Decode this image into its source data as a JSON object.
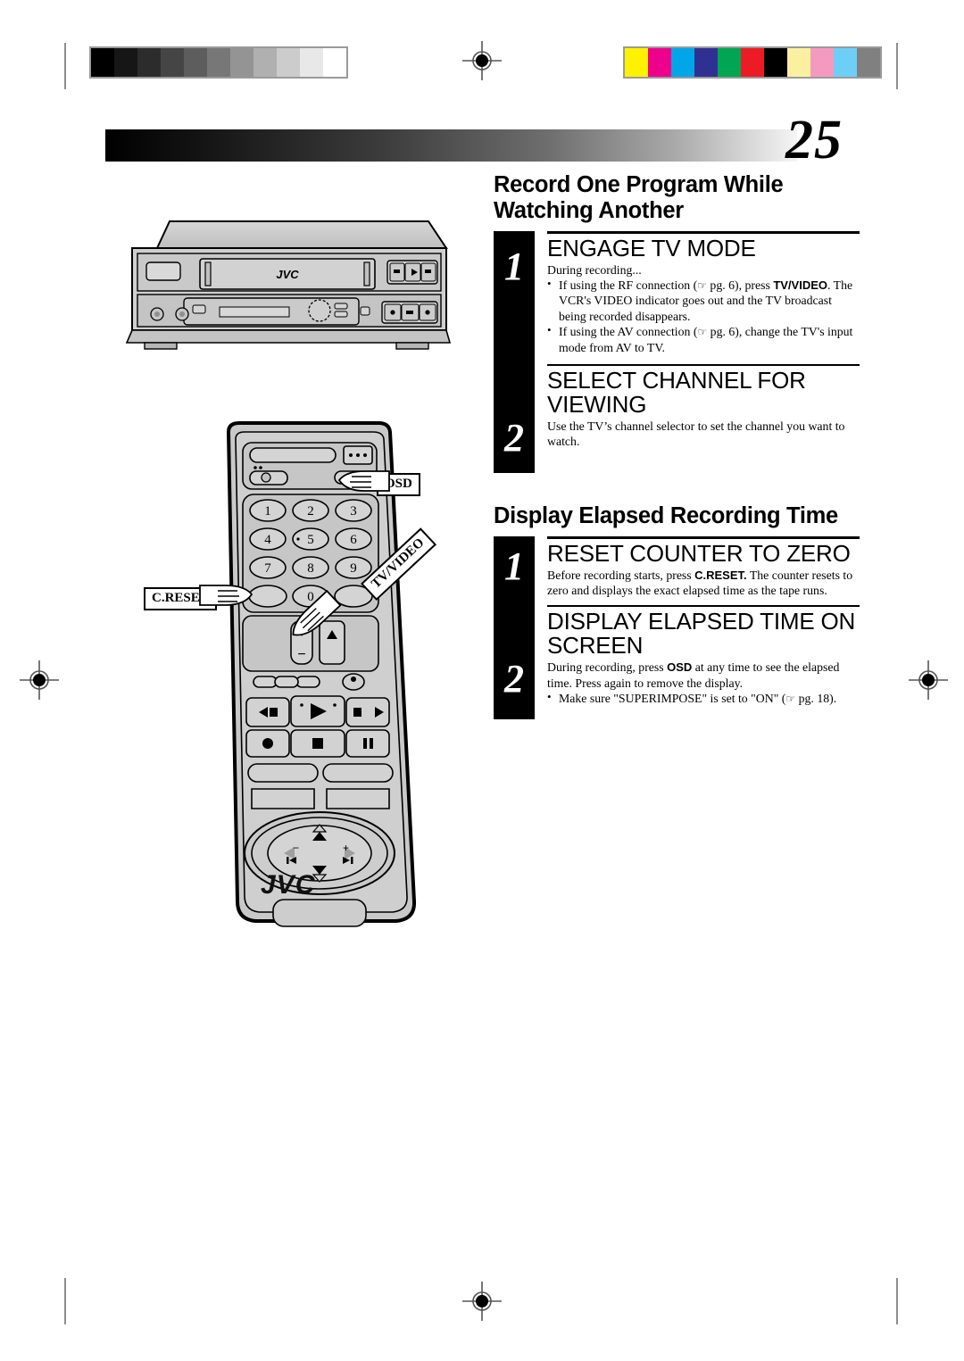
{
  "page": {
    "number": "25"
  },
  "calibration": {
    "gray_wedge_label": "grayscale-step-wedge",
    "gray_steps": [
      "#000000",
      "#161616",
      "#2c2c2c",
      "#454545",
      "#5d5d5d",
      "#777777",
      "#949494",
      "#b0b0b0",
      "#cccccc",
      "#e8e8e8",
      "#ffffff"
    ],
    "color_bar_label": "color-registration-bar",
    "color_swatches": [
      "#fff200",
      "#ec008c",
      "#00a6e8",
      "#2e3192",
      "#00a651",
      "#ed1c24",
      "#000000",
      "#fbf0a0",
      "#f49ac1",
      "#6dcff6",
      "#808080"
    ]
  },
  "sections": [
    {
      "title": "Record One Program While Watching Another",
      "steps": [
        {
          "number": "1",
          "heading": "ENGAGE TV MODE",
          "intro": "During recording...",
          "bullets": [
            {
              "parts": [
                {
                  "t": "If using the RF connection (",
                  "style": "normal"
                },
                {
                  "t": "☞",
                  "style": "hand"
                },
                {
                  "t": " pg. 6), press ",
                  "style": "normal"
                },
                {
                  "t": "TV/VIDEO",
                  "style": "bold"
                },
                {
                  "t": ". The VCR's VIDEO indicator goes out and the TV broadcast being recorded disappears.",
                  "style": "normal"
                }
              ]
            },
            {
              "parts": [
                {
                  "t": "If using the AV connection (",
                  "style": "normal"
                },
                {
                  "t": "☞",
                  "style": "hand"
                },
                {
                  "t": " pg. 6), change the TV's input mode from AV to TV.",
                  "style": "normal"
                }
              ]
            }
          ]
        },
        {
          "number": "2",
          "heading": "SELECT CHANNEL FOR VIEWING",
          "intro": "Use the TV’s channel selector to set the channel you want to watch.",
          "bullets": []
        }
      ]
    },
    {
      "title": "Display Elapsed Recording Time",
      "steps": [
        {
          "number": "1",
          "heading": "RESET COUNTER TO ZERO",
          "intro": "",
          "bullets": [],
          "rich_intro": [
            {
              "t": "Before recording starts, press ",
              "style": "normal"
            },
            {
              "t": "C.RESET.",
              "style": "bold"
            },
            {
              "t": " The counter resets to zero and displays the exact elapsed time as the tape runs.",
              "style": "normal"
            }
          ]
        },
        {
          "number": "2",
          "heading": "DISPLAY ELAPSED TIME ON SCREEN",
          "intro": "",
          "rich_intro": [
            {
              "t": "During recording, press ",
              "style": "normal"
            },
            {
              "t": "OSD",
              "style": "bold"
            },
            {
              "t": " at any time to see the elapsed time. Press again to remove the display.",
              "style": "normal"
            }
          ],
          "bullets": [
            {
              "parts": [
                {
                  "t": "Make sure \"SUPERIMPOSE\" is set to \"ON\" (",
                  "style": "normal"
                },
                {
                  "t": "☞",
                  "style": "hand"
                },
                {
                  "t": " pg. 18).",
                  "style": "normal"
                }
              ]
            }
          ]
        }
      ]
    }
  ],
  "illustrations": {
    "vcr": {
      "name": "vcr-front-panel",
      "brand": "JVC"
    },
    "remote": {
      "name": "remote-control",
      "brand": "JVC",
      "keypad": [
        "1",
        "2",
        "3",
        "4",
        "5",
        "6",
        "7",
        "8",
        "9",
        "0"
      ],
      "volume_plus": "+",
      "volume_minus": "−"
    },
    "callouts": [
      {
        "name": "callout-c-reset",
        "label": "C.RESET"
      },
      {
        "name": "callout-osd",
        "label": "OSD"
      },
      {
        "name": "callout-tv-video",
        "label": "TV/VIDEO"
      }
    ]
  }
}
